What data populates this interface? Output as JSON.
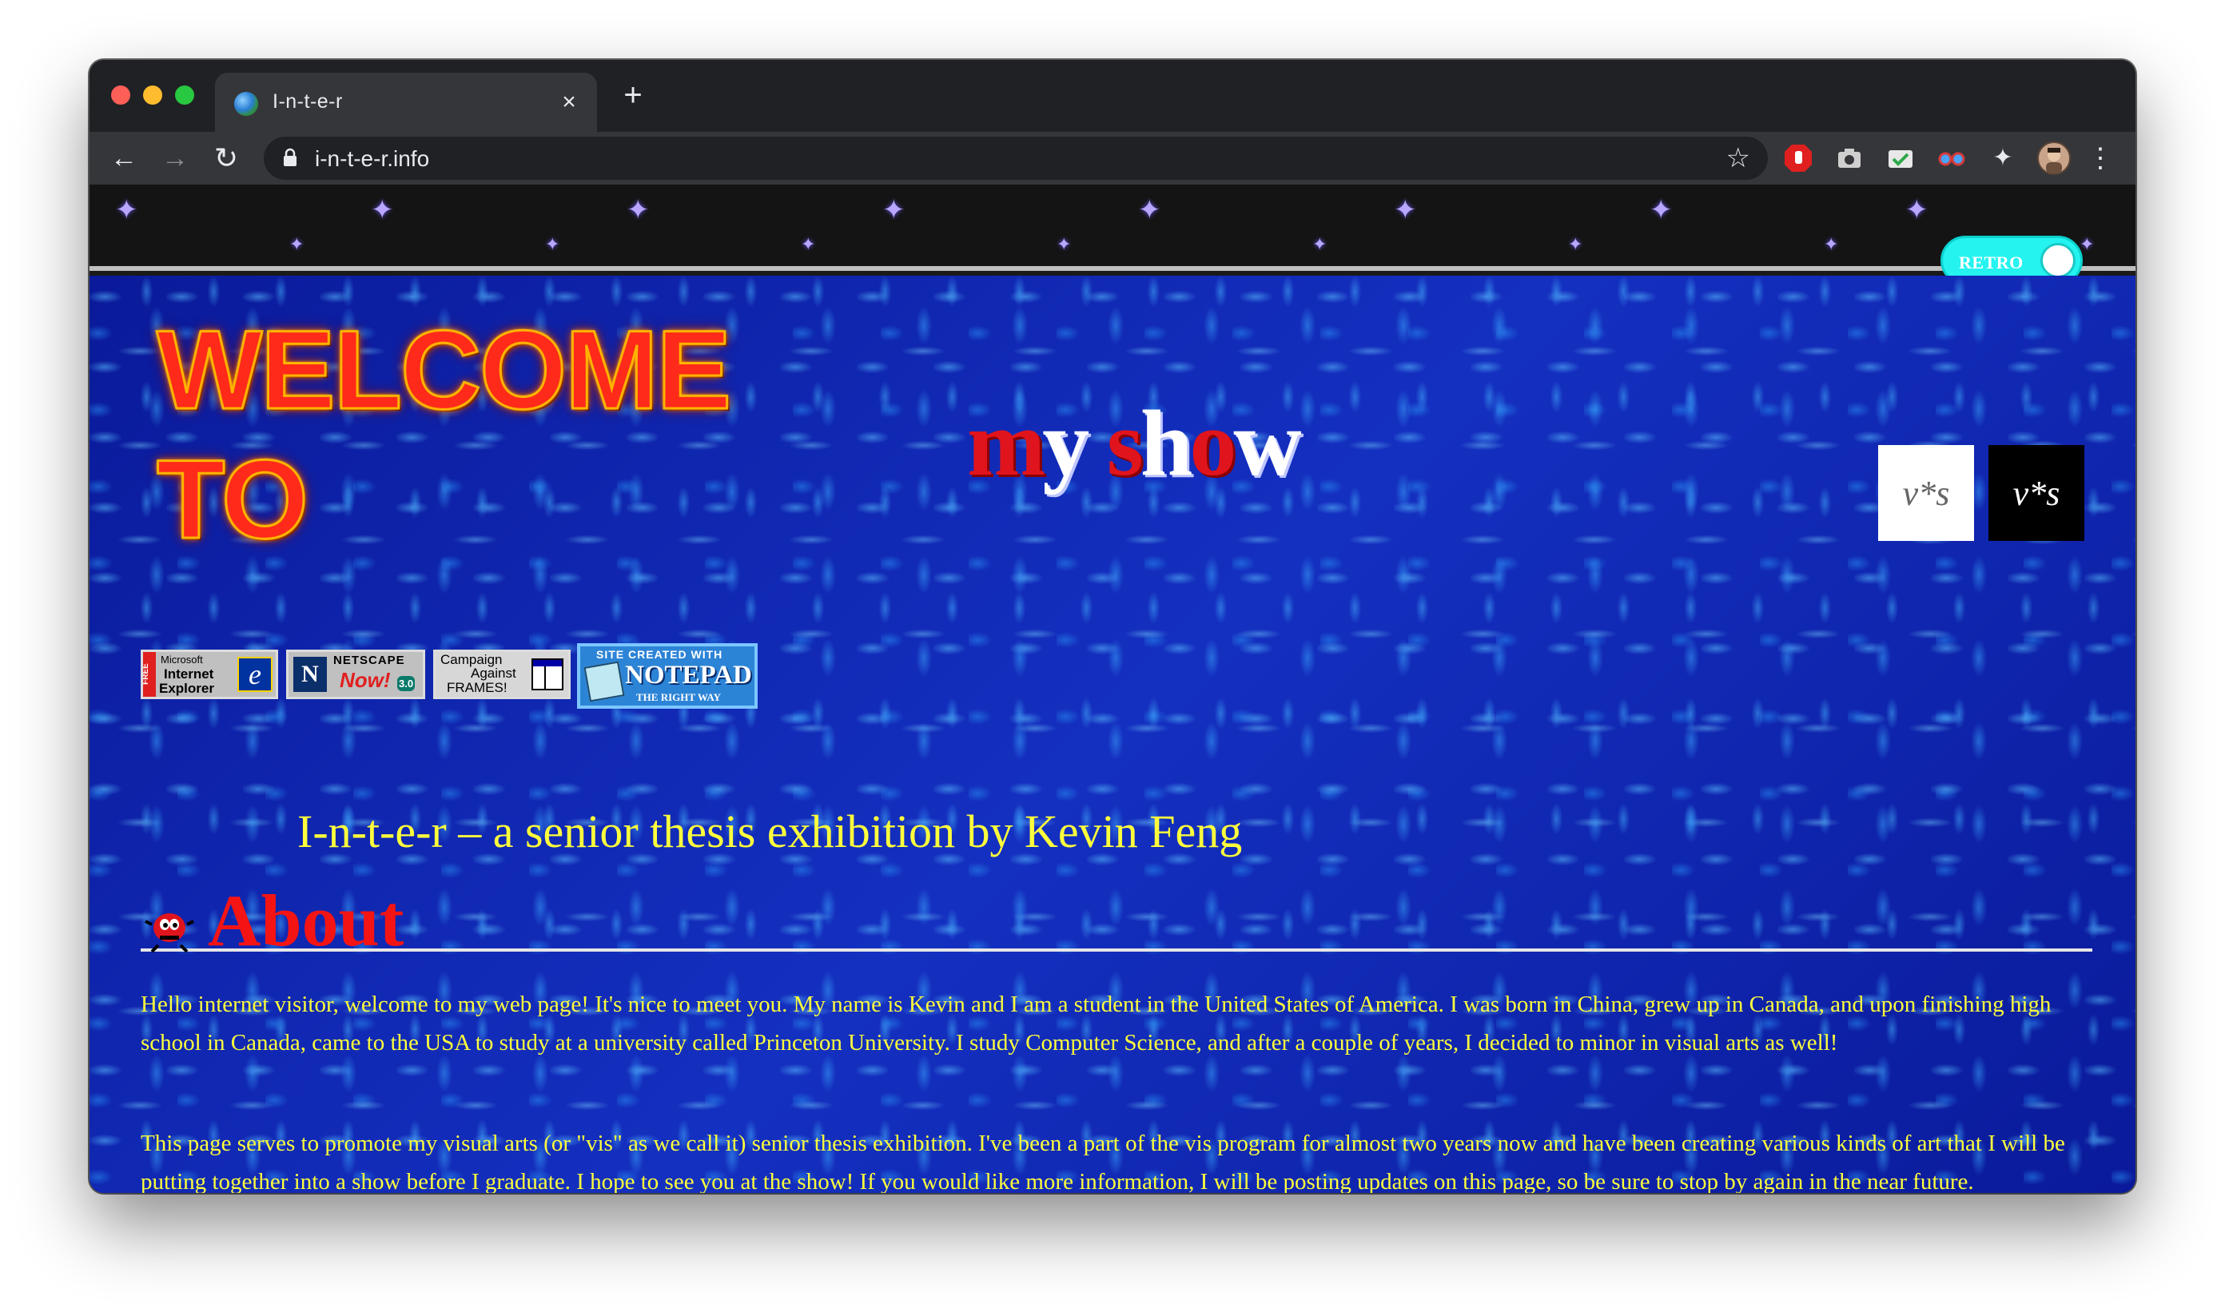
{
  "browser": {
    "tab_title": "I-n-t-e-r",
    "tab_close_glyph": "×",
    "new_tab_glyph": "+",
    "url": "i-n-t-e-r.info"
  },
  "banner": {
    "retro_label": "RETRO"
  },
  "page": {
    "welcome_text": "WELCOME TO",
    "myshow_parts": [
      "m",
      "y",
      " ",
      "s",
      "h",
      "o",
      "w"
    ],
    "vs_logo_text": "v*s",
    "badges": {
      "ie": [
        "Microsoft",
        "Internet",
        "Explorer",
        "FREE"
      ],
      "netscape": [
        "NETSCAPE",
        "Now!",
        "3.0"
      ],
      "caf": [
        "Campaign",
        "Against",
        "FRAMES!"
      ],
      "notepad": [
        "SITE CREATED WITH",
        "NOTEPAD",
        "THE RIGHT WAY"
      ]
    },
    "subtitle": "I-n-t-e-r – a senior thesis exhibition by Kevin Feng",
    "about_title": "About",
    "paragraphs": [
      "Hello internet visitor, welcome to my web page! It's nice to meet you. My name is Kevin and I am a student in the United States of America. I was born in China, grew up in Canada, and upon finishing high school in Canada, came to the USA to study at a university called Princeton University. I study Computer Science, and after a couple of years, I decided to minor in visual arts as well!",
      "This page serves to promote my visual arts (or \"vis\" as we call it) senior thesis exhibition. I've been a part of the vis program for almost two years now and have been creating various kinds of art that I will be putting together into a show before I graduate. I hope to see you at the show! If you would like more information, I will be posting updates on this page, so be sure to stop by again in the near future."
    ]
  },
  "colors": {
    "page_bg": "#0b1fa6",
    "text_yellow": "#ffff3c",
    "heading_red": "#f51414",
    "toggle_cyan": "#25f3f0"
  }
}
